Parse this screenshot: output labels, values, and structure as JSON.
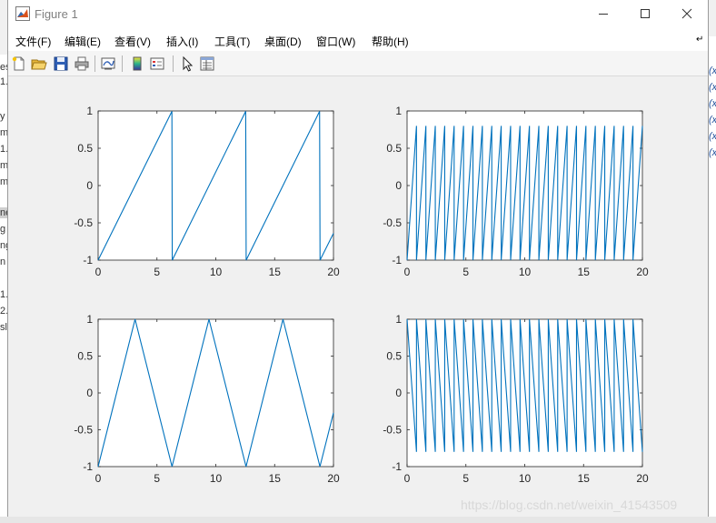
{
  "window": {
    "title": "Figure 1"
  },
  "menu": [
    {
      "label": "文件(F)"
    },
    {
      "label": "编辑(E)"
    },
    {
      "label": "查看(V)"
    },
    {
      "label": "插入(I)"
    },
    {
      "label": "工具(T)"
    },
    {
      "label": "桌面(D)"
    },
    {
      "label": "窗口(W)"
    },
    {
      "label": "帮助(H)"
    }
  ],
  "toolbar": [
    {
      "icon": "new-figure-icon"
    },
    {
      "icon": "open-file-icon"
    },
    {
      "icon": "save-icon"
    },
    {
      "icon": "print-icon"
    },
    {
      "icon": "link-plot-icon"
    },
    {
      "icon": "colorbar-icon"
    },
    {
      "icon": "legend-icon"
    },
    {
      "icon": "edit-plot-arrow-icon"
    },
    {
      "icon": "property-inspector-icon"
    }
  ],
  "watermark": "https://blog.csdn.net/weixin_41543509",
  "colors": {
    "line": "#0072bd",
    "axes_bg": "#ffffff",
    "figure_bg": "#f0f0f0"
  },
  "chart_data": [
    {
      "type": "line",
      "waveform": "sawtooth",
      "period": 6.2832,
      "xlim": [
        0,
        20
      ],
      "ylim": [
        -1,
        1
      ],
      "xticks": [
        0,
        5,
        10,
        15,
        20
      ],
      "yticks": [
        -1,
        -0.5,
        0,
        0.5,
        1
      ],
      "xtick_labels": [
        "0",
        "5",
        "10",
        "15",
        "20"
      ],
      "ytick_labels": [
        "-1",
        "-0.5",
        "0",
        "0.5",
        "1"
      ],
      "points": [
        [
          0,
          -1
        ],
        [
          6.27,
          0.995
        ],
        [
          6.3,
          -1
        ],
        [
          12.54,
          0.995
        ],
        [
          12.58,
          -1
        ],
        [
          18.82,
          0.995
        ],
        [
          18.86,
          -1
        ],
        [
          20,
          -0.64
        ]
      ]
    },
    {
      "type": "line",
      "waveform": "sawtooth",
      "period": 0.8,
      "xlim": [
        0,
        20
      ],
      "ylim": [
        -1,
        1
      ],
      "xticks": [
        0,
        5,
        10,
        15,
        20
      ],
      "yticks": [
        -1,
        -0.5,
        0,
        0.5,
        1
      ],
      "xtick_labels": [
        "0",
        "5",
        "10",
        "15",
        "20"
      ],
      "ytick_labels": [
        "-1",
        "-0.5",
        "0",
        "0.5",
        "1"
      ],
      "y_min": -1,
      "y_max": 0.8
    },
    {
      "type": "line",
      "waveform": "triangle",
      "period": 6.2832,
      "xlim": [
        0,
        20
      ],
      "ylim": [
        -1,
        1
      ],
      "xticks": [
        0,
        5,
        10,
        15,
        20
      ],
      "yticks": [
        -1,
        -0.5,
        0,
        0.5,
        1
      ],
      "xtick_labels": [
        "0",
        "5",
        "10",
        "15",
        "20"
      ],
      "ytick_labels": [
        "-1",
        "-0.5",
        "0",
        "0.5",
        "1"
      ],
      "points": [
        [
          0,
          -1
        ],
        [
          3.14,
          1
        ],
        [
          6.28,
          -1
        ],
        [
          9.42,
          1
        ],
        [
          12.57,
          -1
        ],
        [
          15.71,
          1
        ],
        [
          18.85,
          -1
        ],
        [
          20,
          -0.27
        ]
      ]
    },
    {
      "type": "line",
      "waveform": "reverse-sawtooth",
      "period": 0.8,
      "xlim": [
        0,
        20
      ],
      "ylim": [
        -1,
        1
      ],
      "xticks": [
        0,
        5,
        10,
        15,
        20
      ],
      "yticks": [
        -1,
        -0.5,
        0,
        0.5,
        1
      ],
      "xtick_labels": [
        "0",
        "5",
        "10",
        "15",
        "20"
      ],
      "ytick_labels": [
        "-1",
        "-0.5",
        "0",
        "0.5",
        "1"
      ],
      "y_min": -0.8,
      "y_max": 1
    }
  ]
}
